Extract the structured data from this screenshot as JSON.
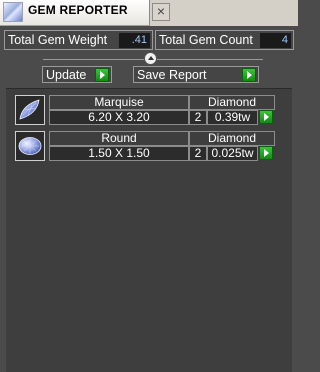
{
  "window": {
    "title": "GEM REPORTER",
    "close_label": "×",
    "icon": "gem-reporter-icon"
  },
  "stats": {
    "total_weight_label": "Total Gem Weight",
    "total_weight_value": ".41",
    "total_count_label": "Total Gem Count",
    "total_count_value": "4"
  },
  "actions": {
    "update_label": "Update",
    "save_report_label": "Save Report"
  },
  "gems": [
    {
      "shape": "Marquise",
      "type": "Diamond",
      "size": "6.20 X 3.20",
      "count": "2",
      "weight": "0.39tw",
      "icon": "marquise-gem-icon"
    },
    {
      "shape": "Round",
      "type": "Diamond",
      "size": "1.50 X 1.50",
      "count": "2",
      "weight": "0.025tw",
      "icon": "round-gem-icon"
    }
  ],
  "colors": {
    "background": "#4b4b4b",
    "accent_green": "#1fa51f",
    "value_text": "#9fc8ff"
  }
}
